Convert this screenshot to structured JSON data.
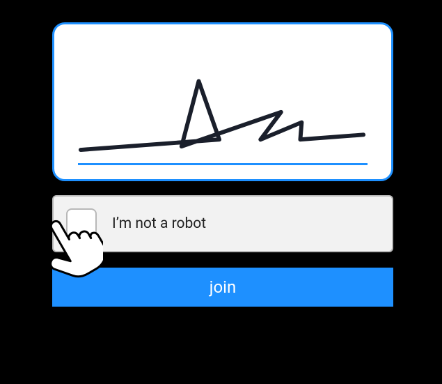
{
  "colors": {
    "accent": "#1e90ff",
    "panel_bg": "#f2f2f2",
    "border_gray": "#b8b8b8"
  },
  "signature": {
    "icon": "signature-scribble"
  },
  "captcha": {
    "label": "I’m not a robot",
    "checked": false
  },
  "submit": {
    "label": "join"
  },
  "cursor": {
    "icon": "pointer-hand"
  }
}
